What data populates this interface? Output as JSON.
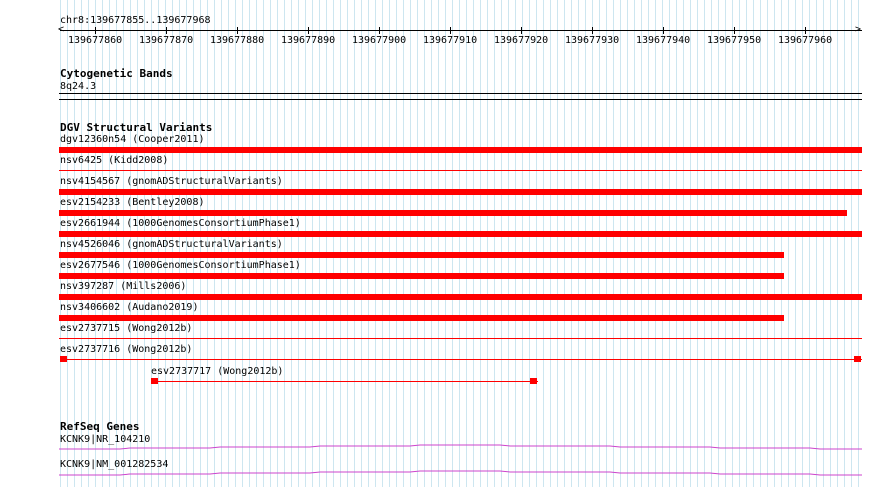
{
  "ruler": {
    "range": "chr8:139677855..139677968",
    "start": 139677855,
    "end": 139677968,
    "ticks": [
      "139677860",
      "139677870",
      "139677880",
      "139677890",
      "139677900",
      "139677910",
      "139677920",
      "139677930",
      "139677940",
      "139677950",
      "139677960"
    ]
  },
  "cytoband": {
    "title": "Cytogenetic Bands",
    "band": "8q24.3"
  },
  "dgv": {
    "title": "DGV Structural Variants",
    "color": "#ff0000",
    "variants": [
      {
        "label": "dgv12360n54 (Cooper2011)"
      },
      {
        "label": "nsv6425 (Kidd2008)"
      },
      {
        "label": "nsv4154567 (gnomADStructuralVariants)"
      },
      {
        "label": "esv2154233 (Bentley2008)"
      },
      {
        "label": "esv2661944 (1000GenomesConsortiumPhase1)"
      },
      {
        "label": "nsv4526046 (gnomADStructuralVariants)"
      },
      {
        "label": "esv2677546 (1000GenomesConsortiumPhase1)"
      },
      {
        "label": "nsv397287 (Mills2006)"
      },
      {
        "label": "nsv3406602 (Audano2019)"
      },
      {
        "label": "esv2737715 (Wong2012b)"
      },
      {
        "label": "esv2737716 (Wong2012b)"
      },
      {
        "label": "esv2737717 (Wong2012b)"
      }
    ]
  },
  "refseq": {
    "title": "RefSeq Genes",
    "color": "#cc44cc",
    "genes": [
      {
        "label": "KCNK9|NR_104210"
      },
      {
        "label": "KCNK9|NM_001282534"
      }
    ]
  }
}
